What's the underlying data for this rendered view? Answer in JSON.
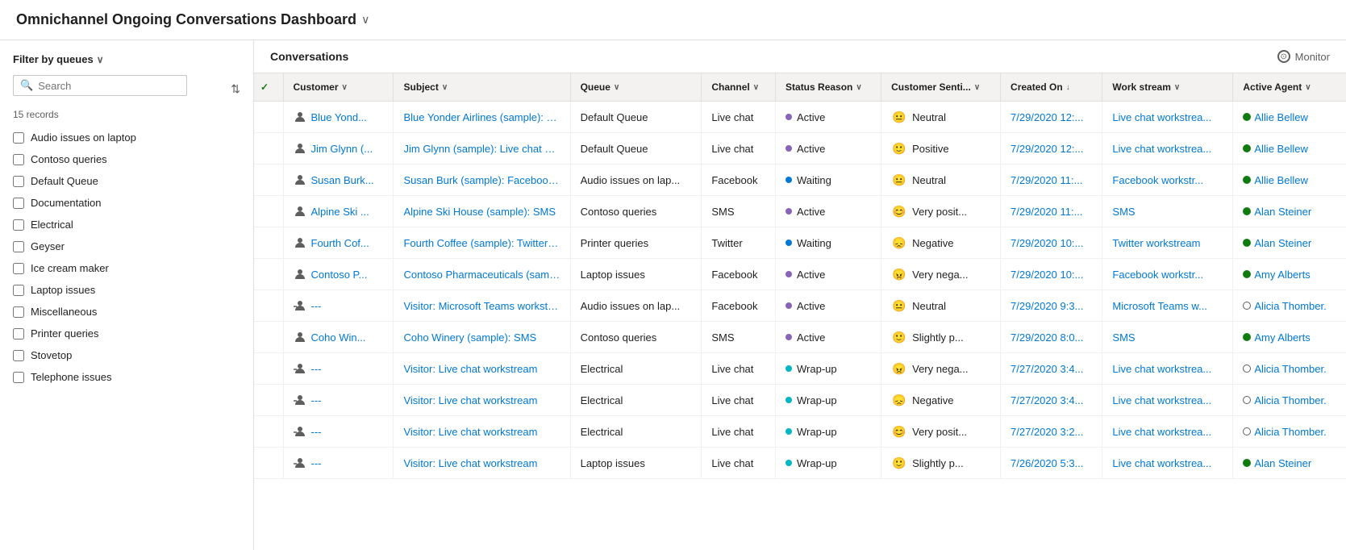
{
  "app": {
    "title": "Omnichannel Ongoing Conversations Dashboard",
    "title_chevron": "∨"
  },
  "sidebar": {
    "filter_label": "Filter by queues",
    "search_placeholder": "Search",
    "records_count": "15 records",
    "queues": [
      {
        "id": 1,
        "name": "Audio issues on laptop",
        "checked": false
      },
      {
        "id": 2,
        "name": "Contoso queries",
        "checked": false
      },
      {
        "id": 3,
        "name": "Default Queue",
        "checked": false
      },
      {
        "id": 4,
        "name": "Documentation",
        "checked": false
      },
      {
        "id": 5,
        "name": "Electrical",
        "checked": false
      },
      {
        "id": 6,
        "name": "Geyser",
        "checked": false
      },
      {
        "id": 7,
        "name": "Ice cream maker",
        "checked": false
      },
      {
        "id": 8,
        "name": "Laptop issues",
        "checked": false
      },
      {
        "id": 9,
        "name": "Miscellaneous",
        "checked": false
      },
      {
        "id": 10,
        "name": "Printer queries",
        "checked": false
      },
      {
        "id": 11,
        "name": "Stovetop",
        "checked": false
      },
      {
        "id": 12,
        "name": "Telephone issues",
        "checked": false
      }
    ]
  },
  "panel": {
    "title": "Conversations",
    "monitor_label": "Monitor"
  },
  "table": {
    "columns": [
      {
        "id": "customer",
        "label": "Customer",
        "sortable": true
      },
      {
        "id": "subject",
        "label": "Subject",
        "sortable": true
      },
      {
        "id": "queue",
        "label": "Queue",
        "sortable": true
      },
      {
        "id": "channel",
        "label": "Channel",
        "sortable": true
      },
      {
        "id": "status_reason",
        "label": "Status Reason",
        "sortable": true
      },
      {
        "id": "customer_sentiment",
        "label": "Customer Senti...",
        "sortable": true
      },
      {
        "id": "created_on",
        "label": "Created On",
        "sortable": true,
        "active_sort": true
      },
      {
        "id": "work_stream",
        "label": "Work stream",
        "sortable": true
      },
      {
        "id": "active_agent",
        "label": "Active Agent",
        "sortable": true
      }
    ],
    "rows": [
      {
        "customer": "Blue Yond...",
        "customer_icon": "person",
        "subject": "Blue Yonder Airlines (sample): Live c...",
        "queue": "Default Queue",
        "channel": "Live chat",
        "status_reason": "Active",
        "status_color": "active",
        "sentiment": "neutral",
        "sentiment_label": "Neutral",
        "created_on": "7/29/2020 12:...",
        "work_stream": "Live chat workstrea...",
        "active_agent": "Allie Bellew",
        "agent_available": true
      },
      {
        "customer": "Jim Glynn (...",
        "customer_icon": "person",
        "subject": "Jim Glynn (sample): Live chat works...",
        "queue": "Default Queue",
        "channel": "Live chat",
        "status_reason": "Active",
        "status_color": "active",
        "sentiment": "positive",
        "sentiment_label": "Positive",
        "created_on": "7/29/2020 12:...",
        "work_stream": "Live chat workstrea...",
        "active_agent": "Allie Bellew",
        "agent_available": true
      },
      {
        "customer": "Susan Burk...",
        "customer_icon": "person",
        "subject": "Susan Burk (sample): Facebook wor...",
        "queue": "Audio issues on lap...",
        "channel": "Facebook",
        "status_reason": "Waiting",
        "status_color": "waiting",
        "sentiment": "neutral",
        "sentiment_label": "Neutral",
        "created_on": "7/29/2020 11:...",
        "work_stream": "Facebook workstr...",
        "active_agent": "Allie Bellew",
        "agent_available": true
      },
      {
        "customer": "Alpine Ski ...",
        "customer_icon": "person",
        "subject": "Alpine Ski House (sample): SMS",
        "queue": "Contoso queries",
        "channel": "SMS",
        "status_reason": "Active",
        "status_color": "active",
        "sentiment": "very_positive",
        "sentiment_label": "Very posit...",
        "created_on": "7/29/2020 11:...",
        "work_stream": "SMS",
        "active_agent": "Alan Steiner",
        "agent_available": true
      },
      {
        "customer": "Fourth Cof...",
        "customer_icon": "person",
        "subject": "Fourth Coffee (sample): Twitter wor...",
        "queue": "Printer queries",
        "channel": "Twitter",
        "status_reason": "Waiting",
        "status_color": "waiting",
        "sentiment": "negative",
        "sentiment_label": "Negative",
        "created_on": "7/29/2020 10:...",
        "work_stream": "Twitter workstream",
        "active_agent": "Alan Steiner",
        "agent_available": true
      },
      {
        "customer": "Contoso P...",
        "customer_icon": "person",
        "subject": "Contoso Pharmaceuticals (sample):...",
        "queue": "Laptop issues",
        "channel": "Facebook",
        "status_reason": "Active",
        "status_color": "active",
        "sentiment": "very_negative",
        "sentiment_label": "Very nega...",
        "created_on": "7/29/2020 10:...",
        "work_stream": "Facebook workstr...",
        "active_agent": "Amy Alberts",
        "agent_available": true
      },
      {
        "customer": "---",
        "customer_icon": "visitor",
        "subject": "Visitor: Microsoft Teams workstrea...",
        "queue": "Audio issues on lap...",
        "channel": "Facebook",
        "status_reason": "Active",
        "status_color": "active",
        "sentiment": "neutral",
        "sentiment_label": "Neutral",
        "created_on": "7/29/2020 9:3...",
        "work_stream": "Microsoft Teams w...",
        "active_agent": "Alicia Thomber.",
        "agent_available": false
      },
      {
        "customer": "Coho Win...",
        "customer_icon": "person",
        "subject": "Coho Winery (sample): SMS",
        "queue": "Contoso queries",
        "channel": "SMS",
        "status_reason": "Active",
        "status_color": "active",
        "sentiment": "slightly_positive",
        "sentiment_label": "Slightly p...",
        "created_on": "7/29/2020 8:0...",
        "work_stream": "SMS",
        "active_agent": "Amy Alberts",
        "agent_available": true
      },
      {
        "customer": "---",
        "customer_icon": "visitor",
        "subject": "Visitor: Live chat workstream",
        "queue": "Electrical",
        "channel": "Live chat",
        "status_reason": "Wrap-up",
        "status_color": "wrapup",
        "sentiment": "very_negative",
        "sentiment_label": "Very nega...",
        "created_on": "7/27/2020 3:4...",
        "work_stream": "Live chat workstrea...",
        "active_agent": "Alicia Thomber.",
        "agent_available": false
      },
      {
        "customer": "---",
        "customer_icon": "visitor",
        "subject": "Visitor: Live chat workstream",
        "queue": "Electrical",
        "channel": "Live chat",
        "status_reason": "Wrap-up",
        "status_color": "wrapup",
        "sentiment": "negative",
        "sentiment_label": "Negative",
        "created_on": "7/27/2020 3:4...",
        "work_stream": "Live chat workstrea...",
        "active_agent": "Alicia Thomber.",
        "agent_available": false
      },
      {
        "customer": "---",
        "customer_icon": "visitor",
        "subject": "Visitor: Live chat workstream",
        "queue": "Electrical",
        "channel": "Live chat",
        "status_reason": "Wrap-up",
        "status_color": "wrapup",
        "sentiment": "very_positive",
        "sentiment_label": "Very posit...",
        "created_on": "7/27/2020 3:2...",
        "work_stream": "Live chat workstrea...",
        "active_agent": "Alicia Thomber.",
        "agent_available": false
      },
      {
        "customer": "---",
        "customer_icon": "visitor",
        "subject": "Visitor: Live chat workstream",
        "queue": "Laptop issues",
        "channel": "Live chat",
        "status_reason": "Wrap-up",
        "status_color": "wrapup",
        "sentiment": "slightly_positive",
        "sentiment_label": "Slightly p...",
        "created_on": "7/26/2020 5:3...",
        "work_stream": "Live chat workstrea...",
        "active_agent": "Alan Steiner",
        "agent_available": true
      }
    ]
  }
}
